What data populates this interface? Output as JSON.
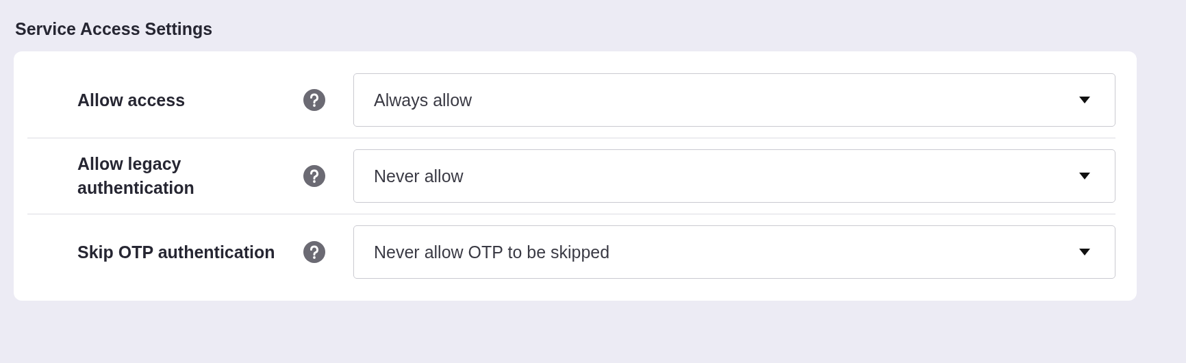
{
  "section": {
    "title": "Service Access Settings"
  },
  "settings": [
    {
      "label": "Allow access",
      "value": "Always allow"
    },
    {
      "label": "Allow legacy authentication",
      "value": "Never allow"
    },
    {
      "label": "Skip OTP authentication",
      "value": "Never allow OTP to be skipped"
    }
  ]
}
